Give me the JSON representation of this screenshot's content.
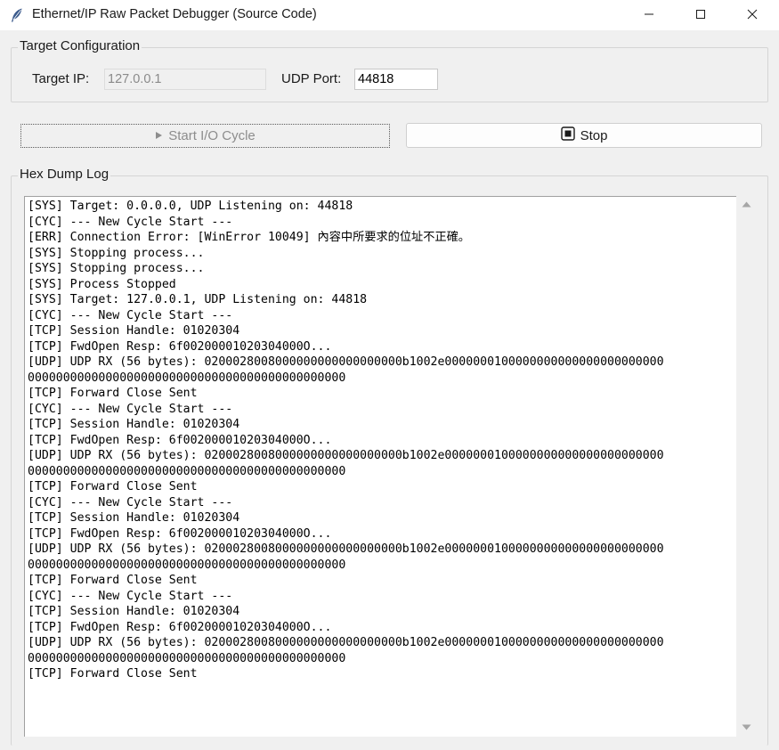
{
  "window": {
    "title": "Ethernet/IP Raw Packet Debugger (Source Code)",
    "icon": "feather-icon",
    "controls": [
      "minimize-icon",
      "maximize-icon",
      "close-icon"
    ]
  },
  "target_config": {
    "title": "Target Configuration",
    "ip_label": "Target IP:",
    "ip_value": "127.0.0.1",
    "port_label": "UDP Port:",
    "port_value": "44818"
  },
  "buttons": {
    "start_label": "Start I/O Cycle",
    "start_icon": "play-icon",
    "stop_label": "Stop",
    "stop_icon": "stop-icon"
  },
  "log": {
    "title": "Hex Dump Log",
    "lines": [
      "[SYS] Target: 0.0.0.0, UDP Listening on: 44818",
      "[CYC] --- New Cycle Start ---",
      "[ERR] Connection Error: [WinError 10049] 內容中所要求的位址不正確。",
      "[SYS] Stopping process...",
      "[SYS] Stopping process...",
      "[SYS] Process Stopped",
      "[SYS] Target: 127.0.0.1, UDP Listening on: 44818",
      "[CYC] --- New Cycle Start ---",
      "[TCP] Session Handle: 01020304",
      "[TCP] FwdOpen Resp: 6f00200001020304000O...",
      "[UDP] UDP RX (56 bytes): 0200028008000000000000000000b1002e0000000100000000000000000000000",
      "000000000000000000000000000000000000000000000",
      "[TCP] Forward Close Sent",
      "[CYC] --- New Cycle Start ---",
      "[TCP] Session Handle: 01020304",
      "[TCP] FwdOpen Resp: 6f00200001020304000O...",
      "[UDP] UDP RX (56 bytes): 0200028008000000000000000000b1002e0000000100000000000000000000000",
      "000000000000000000000000000000000000000000000",
      "[TCP] Forward Close Sent",
      "[CYC] --- New Cycle Start ---",
      "[TCP] Session Handle: 01020304",
      "[TCP] FwdOpen Resp: 6f00200001020304000O...",
      "[UDP] UDP RX (56 bytes): 0200028008000000000000000000b1002e0000000100000000000000000000000",
      "000000000000000000000000000000000000000000000",
      "[TCP] Forward Close Sent",
      "[CYC] --- New Cycle Start ---",
      "[TCP] Session Handle: 01020304",
      "[TCP] FwdOpen Resp: 6f00200001020304000O...",
      "[UDP] UDP RX (56 bytes): 0200028008000000000000000000b1002e0000000100000000000000000000000",
      "000000000000000000000000000000000000000000000",
      "[TCP] Forward Close Sent"
    ]
  },
  "scrollbar": {
    "up_icon": "scroll-up-arrow-icon",
    "down_icon": "scroll-down-arrow-icon"
  }
}
